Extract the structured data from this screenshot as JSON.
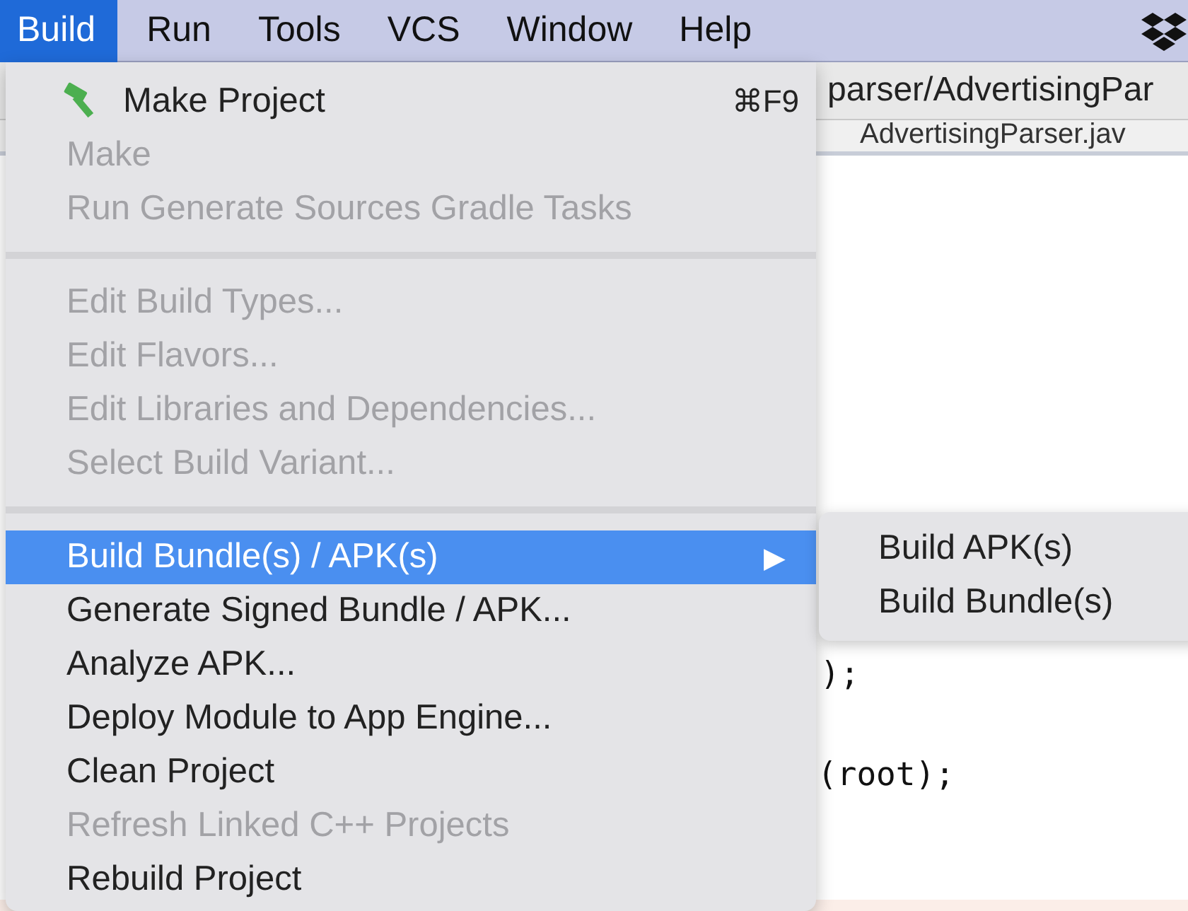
{
  "menu_bar": {
    "items": [
      {
        "label": "Build",
        "selected": true
      },
      {
        "label": "Run",
        "selected": false
      },
      {
        "label": "Tools",
        "selected": false
      },
      {
        "label": "VCS",
        "selected": false
      },
      {
        "label": "Window",
        "selected": false
      },
      {
        "label": "Help",
        "selected": false
      }
    ]
  },
  "editor": {
    "breadcrumb": "parser/AdvertisingPar",
    "tab": "AdvertisingParser.jav",
    "code_lines": [
      ");",
      "(root);"
    ]
  },
  "build_menu": {
    "sections": [
      [
        {
          "label": "Make Project",
          "has_icon": true,
          "shortcut": "⌘F9",
          "disabled": false,
          "selected": false
        },
        {
          "label": "Make",
          "disabled": true,
          "selected": false
        },
        {
          "label": "Run Generate Sources Gradle Tasks",
          "disabled": true,
          "selected": false
        }
      ],
      [
        {
          "label": "Edit Build Types...",
          "disabled": true,
          "selected": false
        },
        {
          "label": "Edit Flavors...",
          "disabled": true,
          "selected": false
        },
        {
          "label": "Edit Libraries and Dependencies...",
          "disabled": true,
          "selected": false
        },
        {
          "label": "Select Build Variant...",
          "disabled": true,
          "selected": false
        }
      ],
      [
        {
          "label": "Build Bundle(s) / APK(s)",
          "arrow": "▶",
          "disabled": false,
          "selected": true
        },
        {
          "label": "Generate Signed Bundle / APK...",
          "disabled": false,
          "selected": false
        },
        {
          "label": "Analyze APK...",
          "disabled": false,
          "selected": false
        },
        {
          "label": "Deploy Module to App Engine...",
          "disabled": false,
          "selected": false
        },
        {
          "label": "Clean Project",
          "disabled": false,
          "selected": false
        },
        {
          "label": "Refresh Linked C++ Projects",
          "disabled": true,
          "selected": false
        },
        {
          "label": "Rebuild Project",
          "disabled": false,
          "selected": false
        }
      ]
    ]
  },
  "submenu": {
    "items": [
      {
        "label": "Build APK(s)",
        "selected": false
      },
      {
        "label": "Build Bundle(s)",
        "selected": false
      }
    ]
  }
}
